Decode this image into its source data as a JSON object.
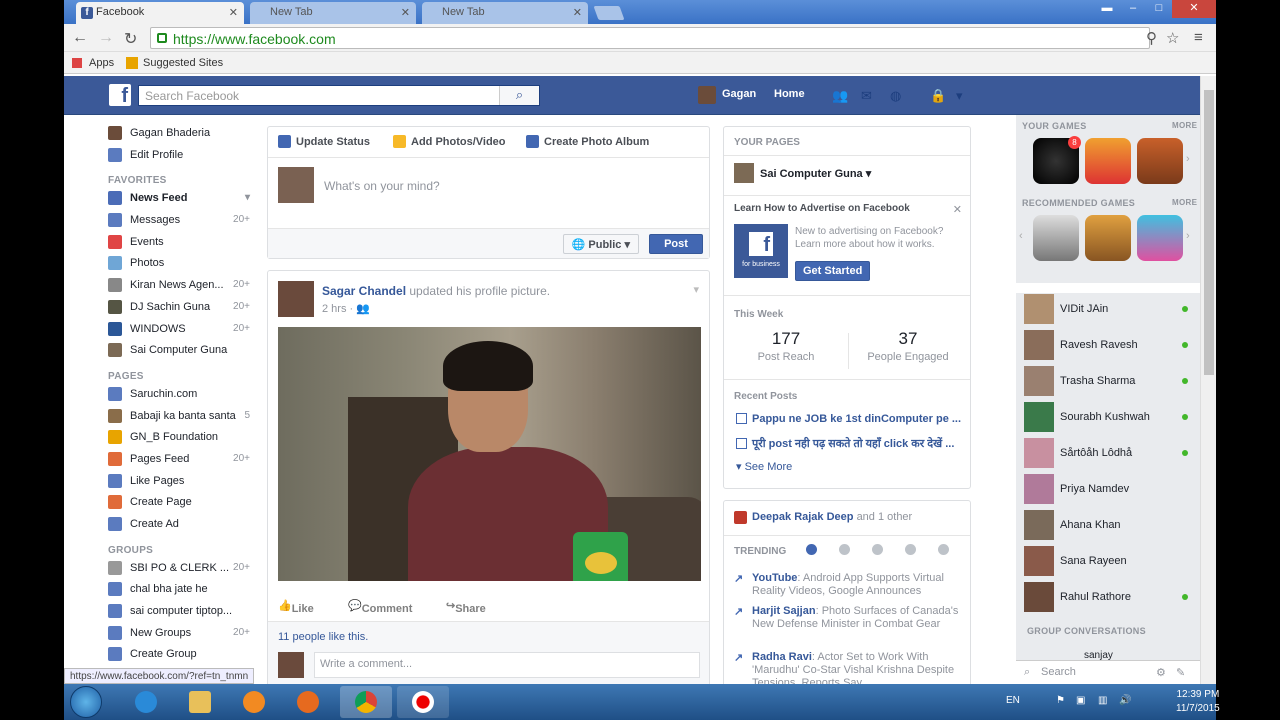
{
  "browser": {
    "tabs": [
      {
        "title": "Facebook",
        "active": true
      },
      {
        "title": "New Tab",
        "active": false
      },
      {
        "title": "New Tab",
        "active": false
      }
    ],
    "url": "https://www.facebook.com",
    "bookmarks": [
      "Apps",
      "Suggested Sites"
    ],
    "status_url": "https://www.facebook.com/?ref=tn_tnmn"
  },
  "fb_header": {
    "search_placeholder": "Search Facebook",
    "user": "Gagan",
    "home": "Home"
  },
  "left_nav": {
    "profile_name": "Gagan Bhaderia",
    "edit_profile": "Edit Profile",
    "favorites_head": "FAVORITES",
    "favorites": [
      {
        "label": "News Feed",
        "count": ""
      },
      {
        "label": "Messages",
        "count": "20+"
      },
      {
        "label": "Events",
        "count": ""
      },
      {
        "label": "Photos",
        "count": ""
      },
      {
        "label": "Kiran News Agen...",
        "count": "20+"
      },
      {
        "label": "DJ Sachin Guna",
        "count": "20+"
      },
      {
        "label": "WINDOWS",
        "count": "20+"
      },
      {
        "label": "Sai Computer Guna",
        "count": ""
      }
    ],
    "pages_head": "PAGES",
    "pages": [
      {
        "label": "Saruchin.com",
        "count": ""
      },
      {
        "label": "Babaji ka banta santa",
        "count": "5"
      },
      {
        "label": "GN_B Foundation",
        "count": ""
      },
      {
        "label": "Pages Feed",
        "count": "20+"
      },
      {
        "label": "Like Pages",
        "count": ""
      },
      {
        "label": "Create Page",
        "count": ""
      },
      {
        "label": "Create Ad",
        "count": ""
      }
    ],
    "groups_head": "GROUPS",
    "groups": [
      {
        "label": "SBI PO & CLERK ...",
        "count": "20+"
      },
      {
        "label": "chal bha jate he",
        "count": ""
      },
      {
        "label": "sai computer tiptop...",
        "count": ""
      },
      {
        "label": "New Groups",
        "count": "20+"
      },
      {
        "label": "Create Group",
        "count": ""
      }
    ]
  },
  "composer": {
    "tab_status": "Update Status",
    "tab_photos": "Add Photos/Video",
    "tab_album": "Create Photo Album",
    "placeholder": "What's on your mind?",
    "privacy": "Public",
    "post": "Post"
  },
  "post": {
    "author": "Sagar Chandel",
    "action": "updated his profile picture.",
    "time": "2 hrs",
    "like": "Like",
    "comment": "Comment",
    "share": "Share",
    "likes_text": "11 people like this.",
    "comment_placeholder": "Write a comment..."
  },
  "your_pages": {
    "head": "YOUR PAGES",
    "page_name": "Sai Computer Guna",
    "ad_title": "Learn How to Advertise on Facebook",
    "ad_text": "New to advertising on Facebook? Learn more about how it works.",
    "ad_logo_text": "for business",
    "get_started": "Get Started",
    "this_week": "This Week",
    "reach_value": "177",
    "reach_label": "Post Reach",
    "engaged_value": "37",
    "engaged_label": "People Engaged",
    "recent_head": "Recent Posts",
    "recent": [
      "Pappu ne JOB ke 1st dinComputer pe ...",
      "पूरी post नही पढ़ सकते तो यहाँ click कर देखें ..."
    ],
    "see_more": "See More"
  },
  "trending": {
    "who": "Deepak Rajak Deep",
    "who_extra": "and 1 other",
    "label": "TRENDING",
    "items": [
      {
        "name": "YouTube",
        "text": ": Android App Supports Virtual Reality Videos, Google Announces"
      },
      {
        "name": "Harjit Sajjan",
        "text": ": Photo Surfaces of Canada's New Defense Minister in Combat Gear"
      },
      {
        "name": "Radha Ravi",
        "text": ": Actor Set to Work With 'Marudhu' Co-Star Vishal Krishna Despite Tensions, Reports Say"
      }
    ]
  },
  "sidebar": {
    "games_head": "YOUR GAMES",
    "more": "MORE",
    "rec_head": "RECOMMENDED GAMES",
    "game_badge": "8",
    "friends": [
      {
        "name": "VIDit JAin",
        "online": true
      },
      {
        "name": "Ravesh Ravesh",
        "online": true
      },
      {
        "name": "Trasha Sharma",
        "online": true
      },
      {
        "name": "Sourabh Kushwah",
        "online": true
      },
      {
        "name": "Sårtôåh Lôdhå",
        "online": true
      },
      {
        "name": "Priya Namdev",
        "online": false
      },
      {
        "name": "Ahana Khan",
        "online": false
      },
      {
        "name": "Sana Rayeen",
        "online": false
      },
      {
        "name": "Rahul Rathore",
        "online": true
      }
    ],
    "group_conv": "GROUP CONVERSATIONS",
    "group_item": "sanjay",
    "search": "Search"
  },
  "taskbar": {
    "lang": "EN",
    "time": "12:39 PM",
    "date": "11/7/2015"
  },
  "colors": {
    "fb_blue": "#3b5998",
    "link": "#365899",
    "online": "#42b72a"
  }
}
